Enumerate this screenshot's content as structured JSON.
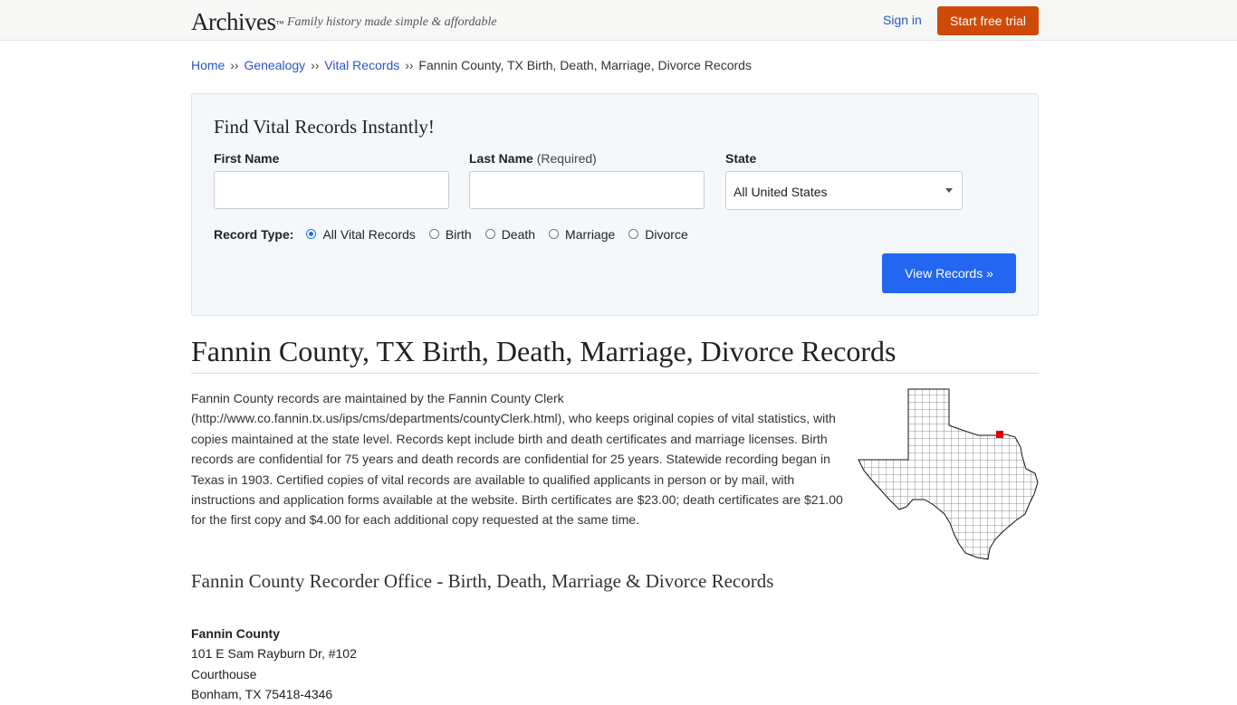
{
  "header": {
    "logo": "Archives",
    "trademark": "™",
    "tagline": "Family history made simple & affordable",
    "sign_in": "Sign in",
    "trial_button": "Start free trial"
  },
  "breadcrumb": {
    "items": [
      "Home",
      "Genealogy",
      "Vital Records"
    ],
    "separator": "››",
    "current": "Fannin County, TX Birth, Death, Marriage, Divorce Records"
  },
  "search": {
    "title": "Find Vital Records Instantly!",
    "first_name_label": "First Name",
    "last_name_label": "Last Name",
    "last_name_required": "(Required)",
    "state_label": "State",
    "state_value": "All United States",
    "record_type_label": "Record Type:",
    "record_types": [
      "All Vital Records",
      "Birth",
      "Death",
      "Marriage",
      "Divorce"
    ],
    "selected_record_type": "All Vital Records",
    "submit_label": "View Records »"
  },
  "content": {
    "title": "Fannin County, TX Birth, Death, Marriage, Divorce Records",
    "intro": "Fannin County records are maintained by the Fannin County Clerk (http://www.co.fannin.tx.us/ips/cms/departments/countyClerk.html), who keeps original copies of vital statistics, with copies maintained at the state level. Records kept include birth and death certificates and marriage licenses. Birth records are confidential for 75 years and death records are confidential for 25 years. Statewide recording began in Texas in 1903. Certified copies of vital records are available to qualified applicants in person or by mail, with instructions and application forms available at the website. Birth certificates are $23.00; death certificates are $21.00 for the first copy and $4.00 for each additional copy requested at the same time.",
    "section_title": "Fannin County Recorder Office - Birth, Death, Marriage & Divorce Records"
  },
  "office": {
    "name": "Fannin County",
    "lines": [
      "101 E Sam Rayburn Dr, #102",
      "Courthouse",
      "Bonham, TX 75418-4346"
    ]
  },
  "colors": {
    "link": "#2a55c8",
    "trial_button": "#cf4a08",
    "view_button": "#2366f0",
    "map_highlight": "#e00000"
  }
}
